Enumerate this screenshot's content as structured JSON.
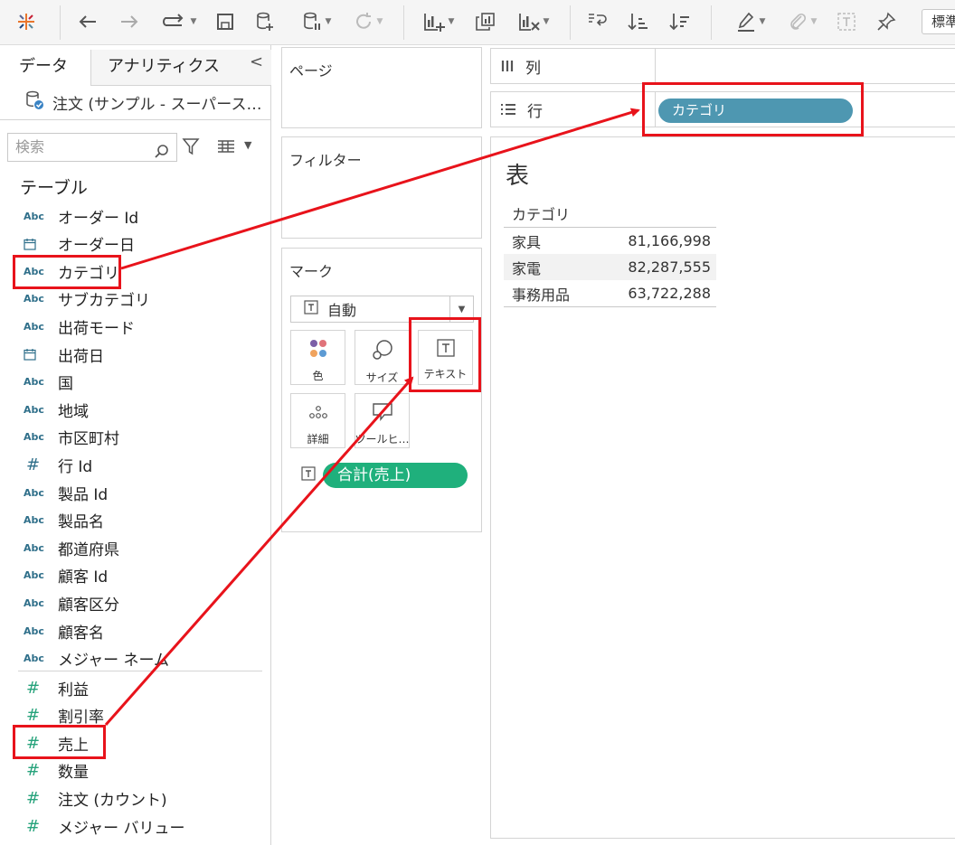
{
  "toolbar": {
    "standard_label": "標準",
    "icons": [
      "tableau-logo-icon",
      "undo-icon",
      "redo-icon",
      "replay-icon",
      "save-icon",
      "new-datasource-icon",
      "pause-updates-icon",
      "refresh-icon",
      "new-worksheet-icon",
      "duplicate-icon",
      "clear-sheet-icon",
      "swap-icon",
      "sort-ascending-icon",
      "sort-descending-icon",
      "highlight-icon",
      "group-icon",
      "label-icon",
      "pin-icon"
    ]
  },
  "data_pane": {
    "tabs": {
      "data": "データ",
      "analytics": "アナリティクス"
    },
    "collapse": "<",
    "datasource": "注文 (サンプル - スーパース…",
    "search_placeholder": "検索",
    "table_heading": "テーブル",
    "dimensions": [
      {
        "type": "Abc",
        "name": "オーダー Id"
      },
      {
        "type": "date",
        "name": "オーダー日"
      },
      {
        "type": "Abc",
        "name": "カテゴリ"
      },
      {
        "type": "Abc",
        "name": "サブカテゴリ"
      },
      {
        "type": "Abc",
        "name": "出荷モード"
      },
      {
        "type": "date",
        "name": "出荷日"
      },
      {
        "type": "Abc",
        "name": "国"
      },
      {
        "type": "Abc",
        "name": "地域"
      },
      {
        "type": "Abc",
        "name": "市区町村"
      },
      {
        "type": "#",
        "name": "行 Id"
      },
      {
        "type": "Abc",
        "name": "製品 Id"
      },
      {
        "type": "Abc",
        "name": "製品名"
      },
      {
        "type": "Abc",
        "name": "都道府県"
      },
      {
        "type": "Abc",
        "name": "顧客 Id"
      },
      {
        "type": "Abc",
        "name": "顧客区分"
      },
      {
        "type": "Abc",
        "name": "顧客名"
      },
      {
        "type": "Abc",
        "name": "メジャー ネーム"
      }
    ],
    "measures": [
      {
        "type": "#",
        "name": "利益"
      },
      {
        "type": "#",
        "name": "割引率"
      },
      {
        "type": "#",
        "name": "売上"
      },
      {
        "type": "#",
        "name": "数量"
      },
      {
        "type": "#",
        "name": "注文 (カウント)"
      },
      {
        "type": "#",
        "name": "メジャー バリュー"
      }
    ]
  },
  "cards": {
    "pages": "ページ",
    "filters": "フィルター",
    "marks": {
      "title": "マーク",
      "type": "自動",
      "buttons": [
        "色",
        "サイズ",
        "テキスト",
        "詳細",
        "ツールヒ…"
      ],
      "pill": "合計(売上)"
    }
  },
  "shelves": {
    "columns": "列",
    "rows": "行",
    "rows_pill": "カテゴリ"
  },
  "view": {
    "title": "表",
    "header": "カテゴリ",
    "rows": [
      {
        "category": "家具",
        "value": "81,166,998"
      },
      {
        "category": "家電",
        "value": "82,287,555"
      },
      {
        "category": "事務用品",
        "value": "63,722,288"
      }
    ]
  },
  "colors": {
    "dimension_pill": "#4e97b1",
    "measure_pill": "#1fb07c",
    "highlight": "#e8131b"
  }
}
